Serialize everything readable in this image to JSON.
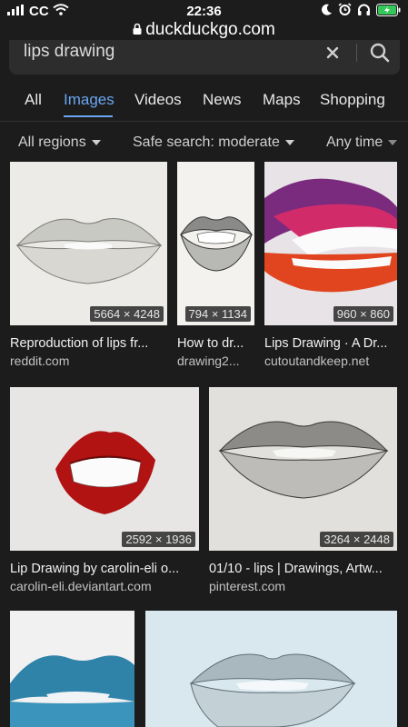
{
  "status": {
    "carrier": "CC",
    "time": "22:36"
  },
  "browser": {
    "url": "duckduckgo.com"
  },
  "search": {
    "query": "lips drawing"
  },
  "tabs": [
    {
      "label": "All",
      "active": false
    },
    {
      "label": "Images",
      "active": true
    },
    {
      "label": "Videos",
      "active": false
    },
    {
      "label": "News",
      "active": false
    },
    {
      "label": "Maps",
      "active": false
    },
    {
      "label": "Shopping",
      "active": false
    }
  ],
  "filters": {
    "region": "All regions",
    "safe_search": "Safe search: moderate",
    "time": "Any time"
  },
  "results": [
    {
      "dims": "5664 × 4248",
      "title": "Reproduction of lips fr...",
      "source": "reddit.com"
    },
    {
      "dims": "794 × 1134",
      "title": "How to dr...",
      "source": "drawing2..."
    },
    {
      "dims": "960 × 860",
      "title": "Lips Drawing · A Dr...",
      "source": "cutoutandkeep.net"
    },
    {
      "dims": "2592 × 1936",
      "title": "Lip Drawing by carolin-eli o...",
      "source": "carolin-eli.deviantart.com"
    },
    {
      "dims": "3264 × 2448",
      "title": "01/10 - lips | Drawings, Artw...",
      "source": "pinterest.com"
    }
  ]
}
